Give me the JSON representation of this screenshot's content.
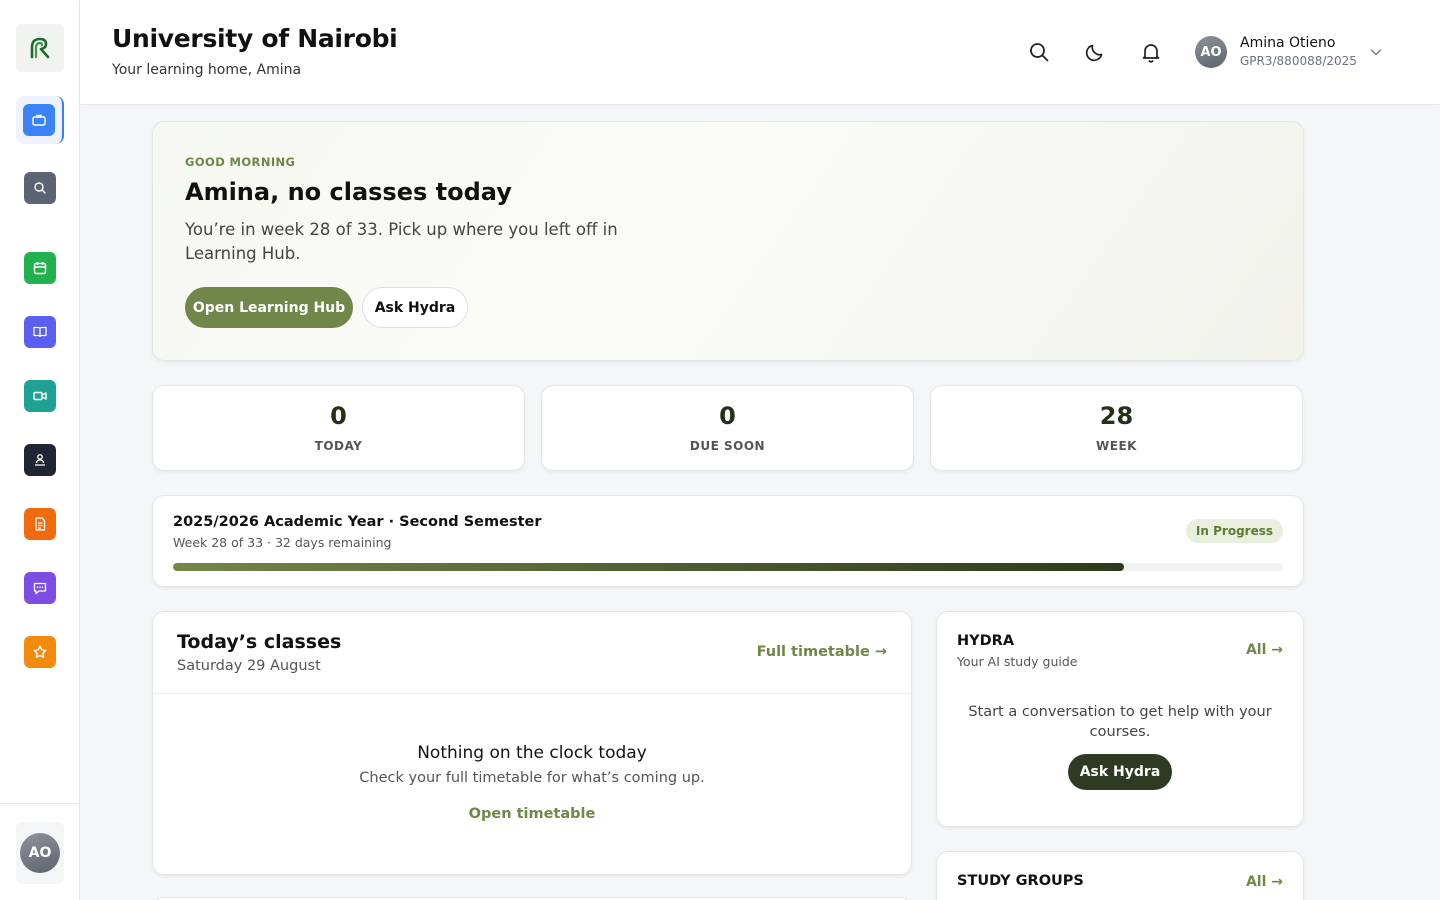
{
  "app": {
    "title": "University of Nairobi",
    "subtitle": "Your learning home, Amina"
  },
  "user": {
    "initials": "AO",
    "name": "Amina Otieno",
    "id": "GPR3/880088/2025"
  },
  "sidebar": {
    "items": [
      {
        "icon": "briefcase-icon",
        "color": "#3b82f6",
        "active": true
      },
      {
        "icon": "search-icon",
        "color": "#5b6474"
      },
      {
        "icon": "calendar-icon",
        "color": "#22b14c"
      },
      {
        "icon": "book-icon",
        "color": "#5b5ef0"
      },
      {
        "icon": "video-icon",
        "color": "#1fa295"
      },
      {
        "icon": "people-icon",
        "color": "#1e2533"
      },
      {
        "icon": "document-icon",
        "color": "#f26a0e"
      },
      {
        "icon": "chat-icon",
        "color": "#7c4ee4"
      },
      {
        "icon": "star-icon",
        "color": "#f28a0e"
      }
    ]
  },
  "hero": {
    "eyebrow": "GOOD MORNING",
    "title": "Amina, no classes today",
    "text": "You’re in week 28 of 33. Pick up where you left off in Learning Hub.",
    "primary_button": "Open Learning Hub",
    "secondary_button": "Ask Hydra"
  },
  "stats": [
    {
      "value": "0",
      "label": "TODAY"
    },
    {
      "value": "0",
      "label": "DUE SOON"
    },
    {
      "value": "28",
      "label": "WEEK"
    }
  ],
  "term": {
    "title": "2025/2026 Academic Year · Second Semester",
    "subtitle": "Week 28 of 33 · 32 days remaining",
    "badge": "In Progress",
    "progress": 0.857
  },
  "classes": {
    "title": "Today’s classes",
    "date": "Saturday 29 August",
    "link": "Full timetable →",
    "empty_title": "Nothing on the clock today",
    "empty_sub": "Check your full timetable for what’s coming up.",
    "empty_link": "Open timetable"
  },
  "hydra": {
    "title": "HYDRA",
    "subtitle": "Your AI study guide",
    "link": "All →",
    "text": "Start a conversation to get help with your courses.",
    "button": "Ask Hydra"
  },
  "groups": {
    "title": "STUDY GROUPS",
    "link": "All →"
  },
  "colors": {
    "accent": "#71874a",
    "dark_accent": "#2f3a23"
  }
}
